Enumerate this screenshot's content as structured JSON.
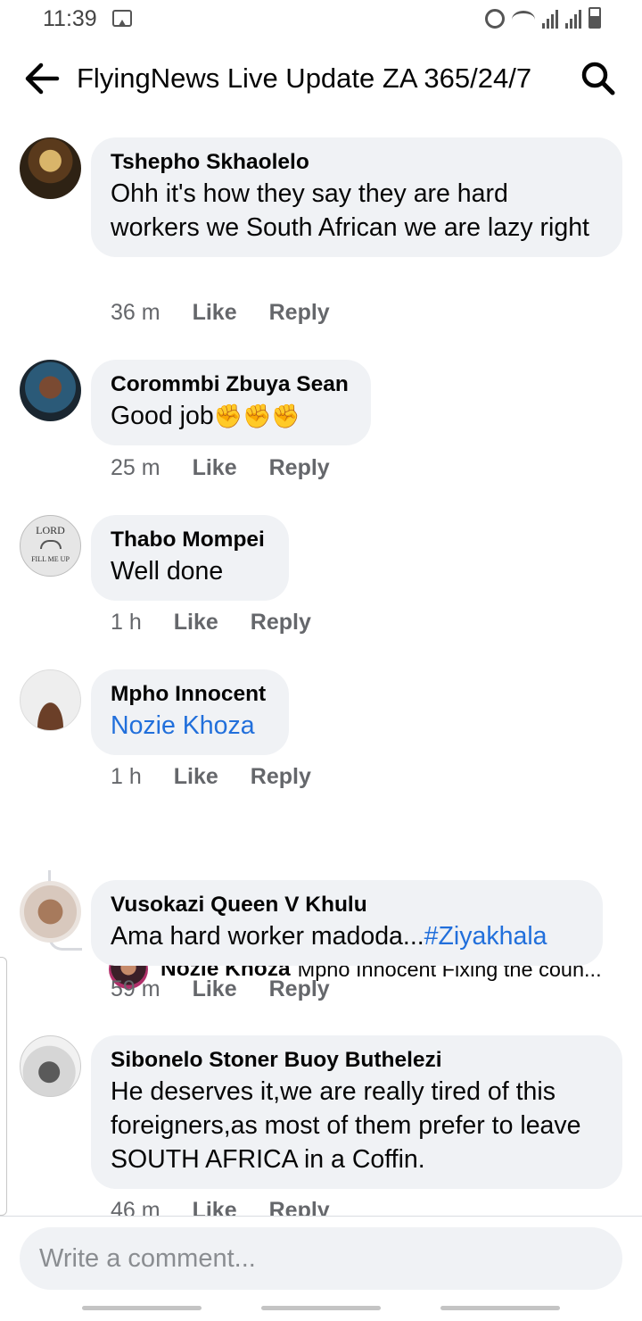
{
  "status_bar": {
    "time": "11:39"
  },
  "header": {
    "title": "FlyingNews Live Update ZA 365/24/7"
  },
  "comments": [
    {
      "author": "Tshepho Skhaolelo",
      "text": "Ohh it's how they say they are hard workers we South African we are lazy right",
      "time": "36 m",
      "like": "Like",
      "reply": "Reply"
    },
    {
      "author": "Corommbi Zbuya Sean",
      "text": "Good job",
      "emoji": "✊✊✊",
      "time": "25 m",
      "like": "Like",
      "reply": "Reply"
    },
    {
      "author": "Thabo Mompei",
      "text": "Well done",
      "avatar_text": [
        "LORD",
        "FILL ME UP"
      ],
      "time": "1 h",
      "like": "Like",
      "reply": "Reply"
    },
    {
      "author": "Mpho Innocent",
      "mention": "Nozie Khoza",
      "time": "1 h",
      "like": "Like",
      "reply": "Reply",
      "reply_preview": {
        "author": "Nozie Khoza",
        "text": "Mpho Innocent Fixing the coun..."
      }
    },
    {
      "author": "Vusokazi Queen V Khulu",
      "text": "Ama hard worker madoda...",
      "hashtag": "#Ziyakhala",
      "time": "59 m",
      "like": "Like",
      "reply": "Reply"
    },
    {
      "author": "Sibonelo Stoner Buoy Buthelezi",
      "text": "He deserves it,we are really tired of this foreigners,as most of them prefer to leave SOUTH AFRICA in a Coffin.",
      "time": "46 m",
      "like": "Like",
      "reply": "Reply"
    }
  ],
  "composer": {
    "placeholder": "Write a comment..."
  },
  "colors": {
    "link": "#216fdb",
    "bubble": "#f0f2f5",
    "meta": "#65676b"
  }
}
